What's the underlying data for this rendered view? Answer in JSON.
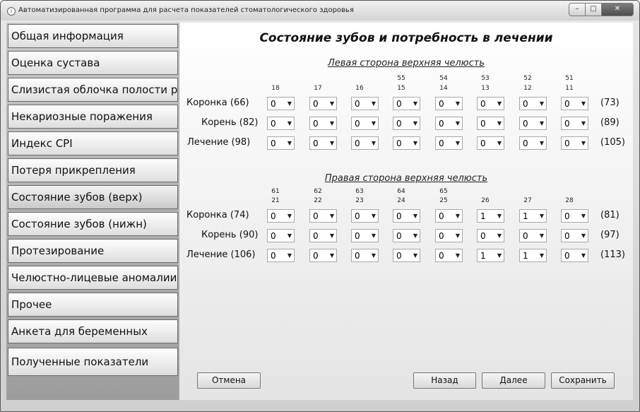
{
  "window": {
    "title": "Автоматизированная программа для расчета показателей стоматологического здоровья",
    "icon": "i"
  },
  "controls": {
    "minimize": "–",
    "maximize": "□",
    "close": "✕"
  },
  "sidebar": {
    "active_index": 6,
    "items": [
      {
        "label": "Общая информация"
      },
      {
        "label": "Оценка сустава"
      },
      {
        "label": "Слизистая облочка полости рта"
      },
      {
        "label": "Некариозные поражения"
      },
      {
        "label": "Индекс CPI"
      },
      {
        "label": "Потеря прикрепления"
      },
      {
        "label": "Состояние зубов (верх)"
      },
      {
        "label": "Состояние зубов (нижн)"
      },
      {
        "label": "Протезирование"
      },
      {
        "label": "Челюстно-лицевые аномалии"
      },
      {
        "label": "Прочее"
      },
      {
        "label": "Анкета для беременных"
      },
      {
        "label": "Полученные показатели"
      }
    ]
  },
  "main": {
    "title": "Состояние зубов и потребность в лечении",
    "sections": [
      {
        "title": "Левая сторона верхняя челюсть",
        "teeth": [
          {
            "top": "",
            "bottom": "18"
          },
          {
            "top": "",
            "bottom": "17"
          },
          {
            "top": "",
            "bottom": "16"
          },
          {
            "top": "55",
            "bottom": "15"
          },
          {
            "top": "54",
            "bottom": "14"
          },
          {
            "top": "53",
            "bottom": "13"
          },
          {
            "top": "52",
            "bottom": "12"
          },
          {
            "top": "51",
            "bottom": "11"
          }
        ],
        "rows": [
          {
            "label": "Коронка",
            "code": "(66)",
            "end": "(73)",
            "values": [
              "0",
              "0",
              "0",
              "0",
              "0",
              "0",
              "0",
              "0"
            ]
          },
          {
            "label": "Корень",
            "code": "(82)",
            "end": "(89)",
            "values": [
              "0",
              "0",
              "0",
              "0",
              "0",
              "0",
              "0",
              "0"
            ]
          },
          {
            "label": "Лечение",
            "code": "(98)",
            "end": "(105)",
            "values": [
              "0",
              "0",
              "0",
              "0",
              "0",
              "0",
              "0",
              "0"
            ]
          }
        ]
      },
      {
        "title": "Правая сторона верхняя челюсть",
        "teeth": [
          {
            "top": "61",
            "bottom": "21"
          },
          {
            "top": "62",
            "bottom": "22"
          },
          {
            "top": "63",
            "bottom": "23"
          },
          {
            "top": "64",
            "bottom": "24"
          },
          {
            "top": "65",
            "bottom": "25"
          },
          {
            "top": "",
            "bottom": "26"
          },
          {
            "top": "",
            "bottom": "27"
          },
          {
            "top": "",
            "bottom": "28"
          }
        ],
        "rows": [
          {
            "label": "Коронка",
            "code": "(74)",
            "end": "(81)",
            "values": [
              "0",
              "0",
              "0",
              "0",
              "0",
              "1",
              "1",
              "0"
            ]
          },
          {
            "label": "Корень",
            "code": "(90)",
            "end": "(97)",
            "values": [
              "0",
              "0",
              "0",
              "0",
              "0",
              "0",
              "0",
              "0"
            ]
          },
          {
            "label": "Лечение",
            "code": "(106)",
            "end": "(113)",
            "values": [
              "0",
              "0",
              "0",
              "0",
              "0",
              "1",
              "1",
              "0"
            ]
          }
        ]
      }
    ],
    "dropdown_icon": "▼"
  },
  "buttons": {
    "cancel": "Отмена",
    "back": "Назад",
    "next": "Далее",
    "save": "Сохранить"
  }
}
